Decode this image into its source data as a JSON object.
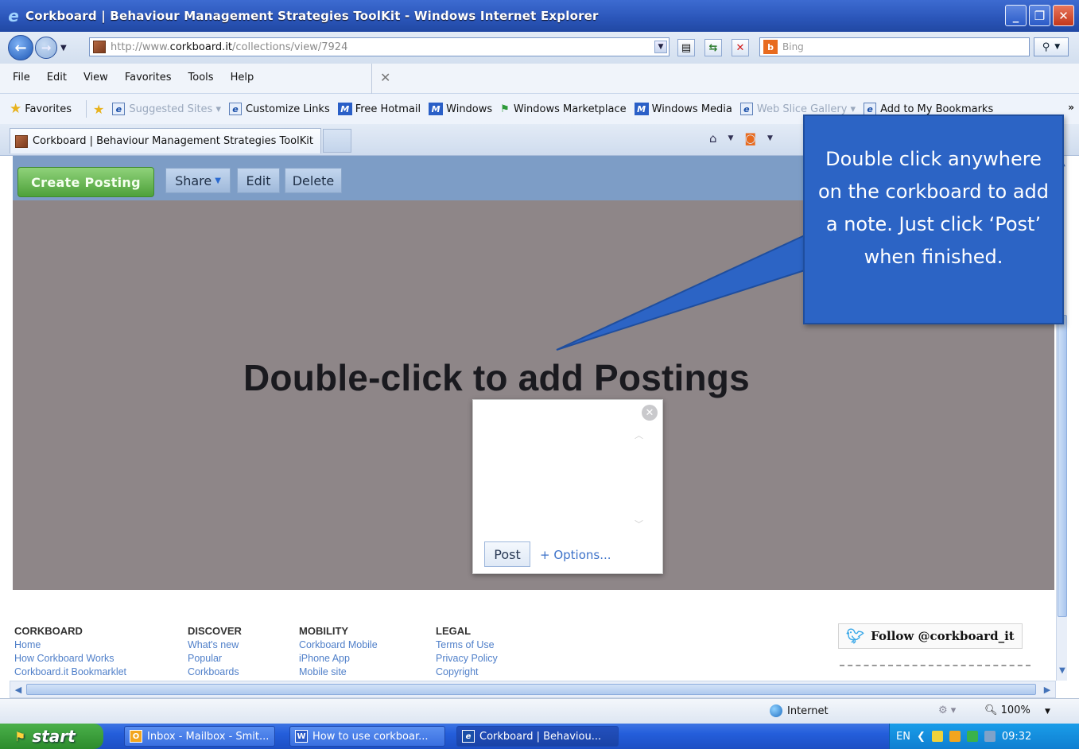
{
  "window": {
    "title": "Corkboard | Behaviour Management Strategies ToolKit - Windows Internet Explorer",
    "buttons": [
      "_",
      "❐",
      "✕"
    ]
  },
  "address": {
    "url_prefix": "http://www.",
    "url_domain": "corkboard.it",
    "url_path": "/collections/view/7924",
    "search_placeholder": "Bing"
  },
  "menu": [
    "File",
    "Edit",
    "View",
    "Favorites",
    "Tools",
    "Help"
  ],
  "favorites_bar": {
    "favorites_label": "Favorites",
    "items": [
      "Suggested Sites ▾",
      "Customize Links",
      "Free Hotmail",
      "Windows",
      "Windows Marketplace",
      "Windows Media",
      "Web Slice Gallery ▾",
      "Add to My Bookmarks"
    ]
  },
  "tab": {
    "label": "Corkboard | Behaviour Management Strategies ToolKit"
  },
  "corkboard": {
    "create_label": "Create Posting",
    "share_label": "Share",
    "edit_label": "Edit",
    "delete_label": "Delete",
    "heading": "Double-click to add Postings",
    "post_label": "Post",
    "options_label": "+ Options..."
  },
  "callout": {
    "text": "Double click anywhere on the corkboard to add a note. Just click ‘Post’ when finished."
  },
  "footer": {
    "columns": [
      {
        "heading": "CORKBOARD",
        "links": [
          "Home",
          "How Corkboard Works",
          "Corkboard.it Bookmarklet"
        ]
      },
      {
        "heading": "DISCOVER",
        "links": [
          "What's new",
          "Popular",
          "Corkboards"
        ]
      },
      {
        "heading": "MOBILITY",
        "links": [
          "Corkboard Mobile",
          "iPhone App",
          "Mobile site"
        ]
      },
      {
        "heading": "LEGAL",
        "links": [
          "Terms of Use",
          "Privacy Policy",
          "Copyright"
        ]
      }
    ],
    "follow_label": "Follow @corkboard_it"
  },
  "status": {
    "zone": "Internet",
    "zoom": "100%"
  },
  "taskbar": {
    "start_label": "start",
    "tasks": [
      "Inbox - Mailbox - Smit...",
      "How to use corkboar...",
      "Corkboard | Behaviou..."
    ],
    "lang": "EN",
    "clock": "09:32"
  },
  "colors": {
    "board": "#8e8688",
    "toolbar": "#7d9dc6",
    "callout": "#2c64c5",
    "create_button": "#4ea13a"
  },
  "icons": [
    "back-arrow-icon",
    "forward-arrow-icon",
    "refresh-icon",
    "stop-icon",
    "search-icon",
    "star-icon",
    "home-icon",
    "rss-icon",
    "close-icon",
    "twitter-icon",
    "globe-icon"
  ]
}
